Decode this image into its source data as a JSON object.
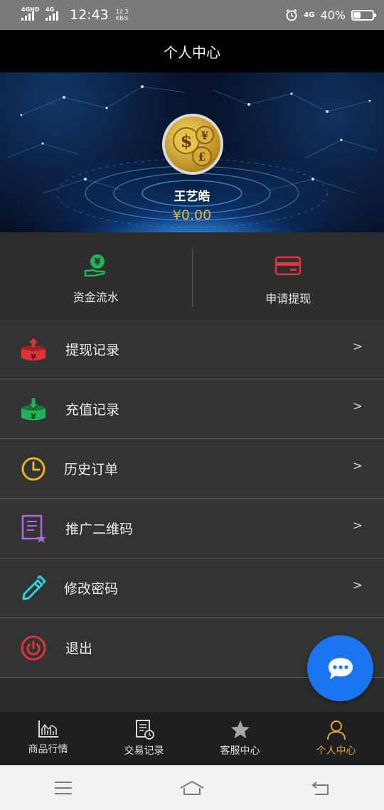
{
  "status_bar": {
    "sim1_network": "4GHD",
    "sim2_network": "4G",
    "time": "12:43",
    "speed_value": "12.3",
    "speed_unit": "KB/s",
    "volte_label": "4G",
    "battery_text": "40%",
    "battery_level": 0.4
  },
  "header": {
    "title": "个人中心"
  },
  "profile": {
    "username": "王艺皓",
    "balance": "¥0.00",
    "balance_color": "#e5b53a"
  },
  "quick_actions": [
    {
      "label": "资金流水",
      "icon": "money-flow-icon",
      "color": "#1fb45a"
    },
    {
      "label": "申请提现",
      "icon": "card-icon",
      "color": "#e0323c"
    }
  ],
  "menu": [
    {
      "label": "提现记录",
      "icon": "withdraw-record-icon",
      "color": "#e0323c",
      "arrow": ">"
    },
    {
      "label": "充值记录",
      "icon": "recharge-record-icon",
      "color": "#1fb45a",
      "arrow": ">"
    },
    {
      "label": "历史订单",
      "icon": "clock-icon",
      "color": "#e6b32c",
      "arrow": ">"
    },
    {
      "label": "推广二维码",
      "icon": "qr-document-icon",
      "color": "#b06ad8",
      "arrow": ">"
    },
    {
      "label": "修改密码",
      "icon": "pencil-icon",
      "color": "#2fd3e0",
      "arrow": ">"
    },
    {
      "label": "退出",
      "icon": "power-icon",
      "color": "#e0323c"
    }
  ],
  "fab": {
    "icon": "chat-bubble-icon",
    "color": "#1976f0"
  },
  "tabs": [
    {
      "label": "商品行情",
      "icon": "chart-icon",
      "active": false
    },
    {
      "label": "交易记录",
      "icon": "record-clock-icon",
      "active": false
    },
    {
      "label": "客服中心",
      "icon": "star-icon",
      "active": false
    },
    {
      "label": "个人中心",
      "icon": "user-icon",
      "active": true
    }
  ],
  "accent_color": "#e5a936",
  "system_nav": {
    "items": [
      "menu-icon",
      "home-icon",
      "back-icon"
    ]
  }
}
